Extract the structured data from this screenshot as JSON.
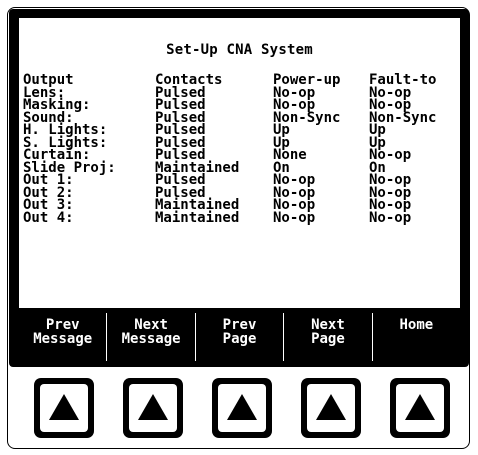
{
  "screen": {
    "title": "Set-Up CNA System",
    "headers": [
      "Output",
      "Contacts",
      "Power-up",
      "Fault-to"
    ],
    "rows": [
      [
        "Lens:",
        "Pulsed",
        "No-op",
        "No-op"
      ],
      [
        "Masking:",
        "Pulsed",
        "No-op",
        "No-op"
      ],
      [
        "Sound:",
        "Pulsed",
        "Non-Sync",
        "Non-Sync"
      ],
      [
        "H. Lights:",
        "Pulsed",
        "Up",
        "Up"
      ],
      [
        "S. Lights:",
        "Pulsed",
        "Up",
        "Up"
      ],
      [
        "Curtain:",
        "Pulsed",
        "None",
        "No-op"
      ],
      [
        "Slide Proj:",
        "Maintained",
        "On",
        "On"
      ],
      [
        "Out 1:",
        "Pulsed",
        "No-op",
        "No-op"
      ],
      [
        "Out 2:",
        "Pulsed",
        "No-op",
        "No-op"
      ],
      [
        "Out 3:",
        "Maintained",
        "No-op",
        "No-op"
      ],
      [
        "Out 4:",
        "Maintained",
        "No-op",
        "No-op"
      ]
    ]
  },
  "softkeys": [
    {
      "line1": "Prev",
      "line2": "Message"
    },
    {
      "line1": "Next",
      "line2": "Message"
    },
    {
      "line1": "Prev",
      "line2": "Page"
    },
    {
      "line1": "Next",
      "line2": "Page"
    },
    {
      "line1": "Home",
      "line2": ""
    }
  ],
  "buttons": {
    "icon": "triangle-up-icon",
    "count": 5
  }
}
